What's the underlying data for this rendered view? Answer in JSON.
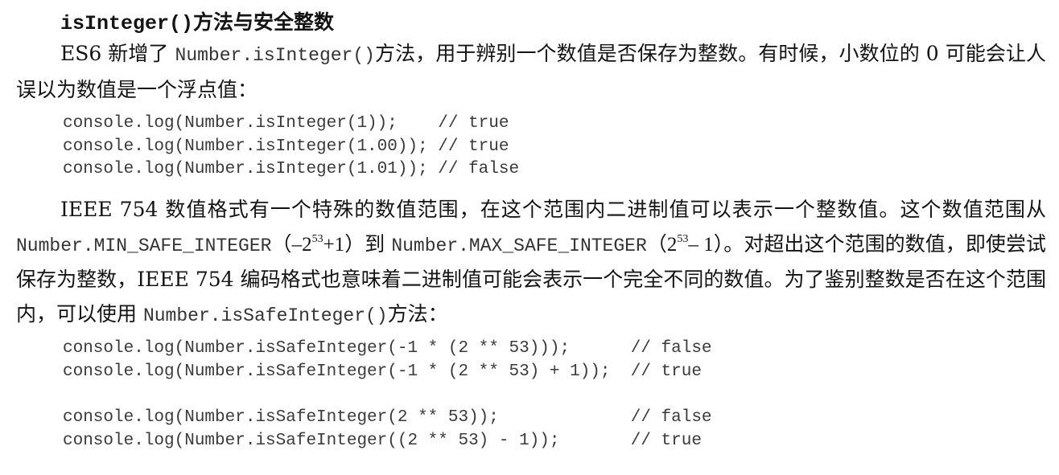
{
  "heading": {
    "code": "isInteger()",
    "text": "方法与安全整数"
  },
  "para1": {
    "t1": "ES6 新增了 ",
    "code1": "Number.isInteger()",
    "t2": "方法，用于辨别一个数值是否保存为整数。有时候，小数位的 0 可能会让人误以为数值是一个浮点值："
  },
  "code_block1": {
    "lines": [
      "console.log(Number.isInteger(1));    // true",
      "console.log(Number.isInteger(1.00)); // true",
      "console.log(Number.isInteger(1.01)); // false"
    ]
  },
  "para2": {
    "t1": "IEEE 754 数值格式有一个特殊的数值范围，在这个范围内二进制值可以表示一个整数值。这个数值范围从 ",
    "code1": "Number.MIN_SAFE_INTEGER",
    "paren_open1": "（",
    "min_expr_base": "–2",
    "exp1": "53",
    "min_expr_tail": "+1",
    "paren_close1": "）到 ",
    "code2": "Number.MAX_SAFE_INTEGER",
    "paren_open2": "（",
    "max_expr_base": "2",
    "exp2": "53",
    "max_expr_tail": "– 1",
    "paren_close2": "）。",
    "t2": "对超出这个范围的数值，即使尝试保存为整数，IEEE 754 编码格式也意味着二进制值可能会表示一个完全不同的数值。为了鉴别整数是否在这个范围内，可以使用 ",
    "code3": "Number.isSafeInteger()",
    "t3": "方法："
  },
  "code_block2": {
    "lines": [
      "console.log(Number.isSafeInteger(-1 * (2 ** 53)));      // false",
      "console.log(Number.isSafeInteger(-1 * (2 ** 53) + 1));  // true"
    ]
  },
  "code_block3": {
    "lines": [
      "console.log(Number.isSafeInteger(2 ** 53));             // false",
      "console.log(Number.isSafeInteger((2 ** 53) - 1));       // true"
    ]
  }
}
